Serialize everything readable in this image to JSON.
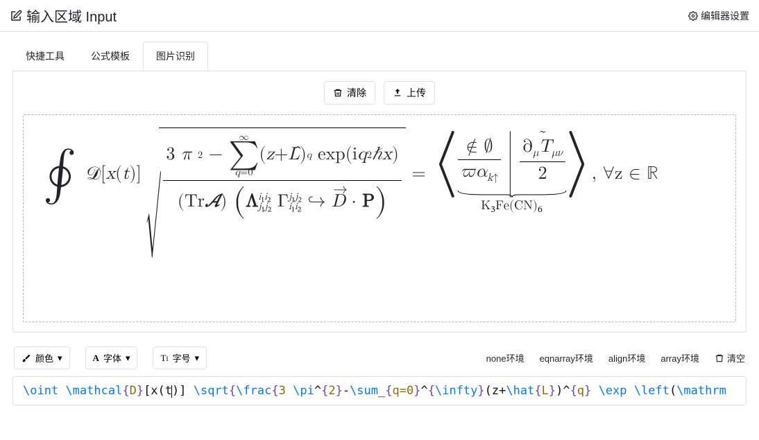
{
  "header": {
    "title": "输入区域 Input",
    "settings": "编辑器设置"
  },
  "tabs": {
    "t1": "快捷工具",
    "t2": "公式模板",
    "t3": "图片识别"
  },
  "actions": {
    "clear": "清除",
    "upload": "上传"
  },
  "toolbar": {
    "color": "颜色",
    "font": "字体",
    "size": "字号",
    "env_none": "none环境",
    "env_eqnarray": "eqnarray环境",
    "env_align": "align环境",
    "env_array": "array环境",
    "empty": "清空"
  },
  "formula": {
    "latex_raw": "\\oint \\mathcal{D}[x(t)] \\sqrt{\\frac{3 \\pi^{2}-\\sum_{q=0}^{\\infty}(z+\\hat{L})^{q} \\exp \\left(\\mathrm{i} q^{2} \\hbar x\\right)}{(\\operatorname{Tr}\\mathcal{A}) \\left(\\Lambda_{j_{1}j_{2}}^{i_{1}i_{2}} \\Gamma_{i_{1}i_{2}}^{j_{1}j_{2}} \\hookrightarrow \\vec{D}\\cdot\\mathbf{P}\\right)}} = \\underbrace{\\left\\langle \\frac{\\notin \\emptyset}{\\varpi \\alpha_{k\\uparrow}} \\middle| \\frac{\\widetilde{\\partial_{\\mu} T_{\\mu\\nu}}}{2} \\right\\rangle}_{\\mathrm{K_{3}Fe(CN)_{6}}}, \\forall z \\in \\mathbb{R}",
    "underbrace_label": "K₃Fe(CN)₆",
    "trailing_text": ", ∀z ∈ ℝ"
  },
  "code_tokens": [
    {
      "t": "cmd",
      "v": "\\oint "
    },
    {
      "t": "cmd",
      "v": "\\mathcal"
    },
    {
      "t": "brace",
      "v": "{"
    },
    {
      "t": "arg",
      "v": "D"
    },
    {
      "t": "brace",
      "v": "}"
    },
    {
      "t": "lit",
      "v": "[x(t"
    },
    {
      "t": "caret",
      "v": ""
    },
    {
      "t": "lit",
      "v": ")] "
    },
    {
      "t": "cmd",
      "v": "\\sqrt"
    },
    {
      "t": "brace",
      "v": "{"
    },
    {
      "t": "cmd",
      "v": "\\frac"
    },
    {
      "t": "brace",
      "v": "{"
    },
    {
      "t": "arg",
      "v": "3 "
    },
    {
      "t": "cmd",
      "v": "\\pi"
    },
    {
      "t": "lit",
      "v": "^"
    },
    {
      "t": "brace",
      "v": "{"
    },
    {
      "t": "arg",
      "v": "2"
    },
    {
      "t": "brace",
      "v": "}"
    },
    {
      "t": "lit",
      "v": "-"
    },
    {
      "t": "cmd",
      "v": "\\sum"
    },
    {
      "t": "lit",
      "v": "_"
    },
    {
      "t": "brace",
      "v": "{"
    },
    {
      "t": "arg",
      "v": "q=0"
    },
    {
      "t": "brace",
      "v": "}"
    },
    {
      "t": "lit",
      "v": "^"
    },
    {
      "t": "brace",
      "v": "{"
    },
    {
      "t": "cmd",
      "v": "\\infty"
    },
    {
      "t": "brace",
      "v": "}"
    },
    {
      "t": "lit",
      "v": "(z+"
    },
    {
      "t": "cmd",
      "v": "\\hat"
    },
    {
      "t": "brace",
      "v": "{"
    },
    {
      "t": "arg",
      "v": "L"
    },
    {
      "t": "brace",
      "v": "}"
    },
    {
      "t": "lit",
      "v": ")^"
    },
    {
      "t": "brace",
      "v": "{"
    },
    {
      "t": "arg",
      "v": "q"
    },
    {
      "t": "brace",
      "v": "}"
    },
    {
      "t": "lit",
      "v": " "
    },
    {
      "t": "cmd",
      "v": "\\exp "
    },
    {
      "t": "cmd",
      "v": "\\left"
    },
    {
      "t": "lit",
      "v": "("
    },
    {
      "t": "cmd",
      "v": "\\mathrm"
    }
  ]
}
